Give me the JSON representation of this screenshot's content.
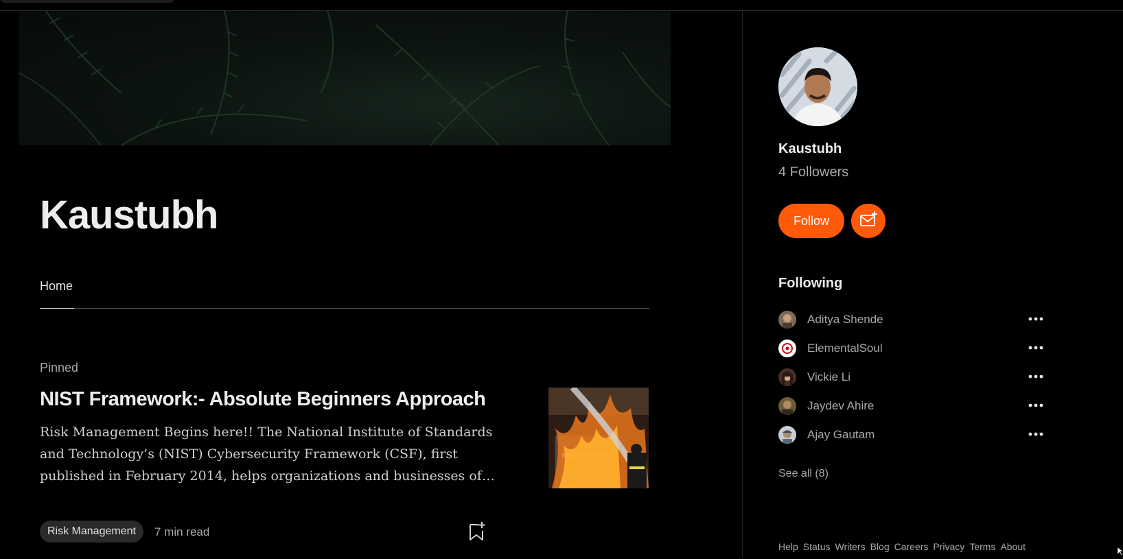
{
  "profile": {
    "title": "Kaustubh"
  },
  "tabs": [
    {
      "label": "Home"
    }
  ],
  "post": {
    "pinned_label": "Pinned",
    "title": "NIST Framework:- Absolute Beginners Approach",
    "excerpt": "Risk Management Begins here!! The National Institute of Standards and Technology’s (NIST) Cybersecurity Framework (CSF), first published in February 2014, helps organizations and businesses of all…",
    "tag": "Risk Management",
    "read_time": "7 min read",
    "thumbnail_icon": "burning-house-image"
  },
  "sidebar": {
    "name": "Kaustubh",
    "followers": "4 Followers",
    "follow_label": "Follow",
    "subscribe_icon": "mail-plus-icon",
    "following_heading": "Following",
    "following": [
      {
        "name": "Aditya Shende"
      },
      {
        "name": "ElementalSoul"
      },
      {
        "name": "Vickie Li"
      },
      {
        "name": "Jaydev Ahire"
      },
      {
        "name": "Ajay Gautam"
      }
    ],
    "see_all": "See all (8)",
    "footer": [
      "Help",
      "Status",
      "Writers",
      "Blog",
      "Careers",
      "Privacy",
      "Terms",
      "About"
    ]
  },
  "colors": {
    "accent": "#ff5a0a",
    "background": "#000000"
  }
}
